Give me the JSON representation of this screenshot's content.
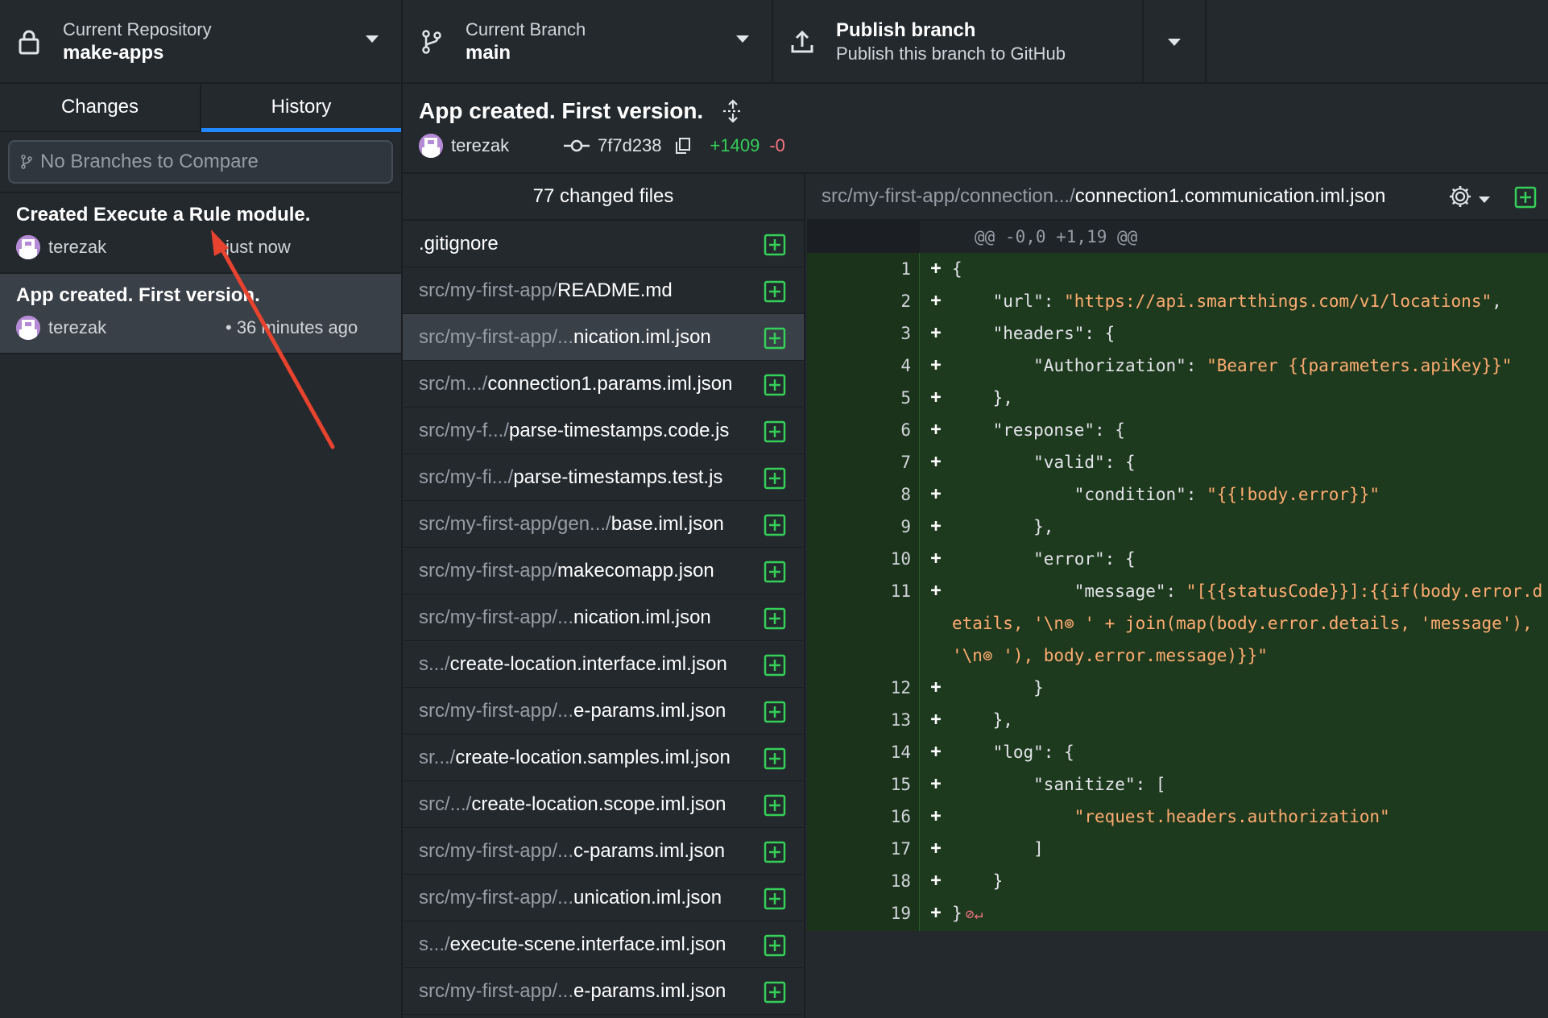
{
  "toolbar": {
    "repo_label": "Current Repository",
    "repo_value": "make-apps",
    "branch_label": "Current Branch",
    "branch_value": "main",
    "publish_label": "Publish branch",
    "publish_sub": "Publish this branch to GitHub"
  },
  "sidebar": {
    "tabs": [
      {
        "label": "Changes",
        "active": false
      },
      {
        "label": "History",
        "active": true
      }
    ],
    "compare_placeholder": "No Branches to Compare",
    "commits": [
      {
        "title": "Created Execute a Rule module.",
        "author": "terezak",
        "time": "just now"
      },
      {
        "title": "App created. First version.",
        "author": "terezak",
        "time": "• 36 minutes ago"
      }
    ]
  },
  "commit": {
    "title": "App created. First version.",
    "author": "terezak",
    "sha": "7f7d238",
    "additions": "+1409",
    "deletions": "-0"
  },
  "files": {
    "header": "77 changed files",
    "items": [
      {
        "dir": "",
        "name": ".gitignore"
      },
      {
        "dir": "src/my-first-app/",
        "name": "README.md"
      },
      {
        "dir": "src/my-first-app/...",
        "name": "nication.iml.json"
      },
      {
        "dir": "src/m.../",
        "name": "connection1.params.iml.json"
      },
      {
        "dir": "src/my-f.../",
        "name": "parse-timestamps.code.js"
      },
      {
        "dir": "src/my-fi.../",
        "name": "parse-timestamps.test.js"
      },
      {
        "dir": "src/my-first-app/gen.../",
        "name": "base.iml.json"
      },
      {
        "dir": "src/my-first-app/",
        "name": "makecomapp.json"
      },
      {
        "dir": "src/my-first-app/...",
        "name": "nication.iml.json"
      },
      {
        "dir": "s.../",
        "name": "create-location.interface.iml.json"
      },
      {
        "dir": "src/my-first-app/...",
        "name": "e-params.iml.json"
      },
      {
        "dir": "sr.../",
        "name": "create-location.samples.iml.json"
      },
      {
        "dir": "src/.../",
        "name": "create-location.scope.iml.json"
      },
      {
        "dir": "src/my-first-app/...",
        "name": "c-params.iml.json"
      },
      {
        "dir": "src/my-first-app/...",
        "name": "unication.iml.json"
      },
      {
        "dir": "s.../",
        "name": "execute-scene.interface.iml.json"
      },
      {
        "dir": "src/my-first-app/...",
        "name": "e-params.iml.json"
      }
    ]
  },
  "diff": {
    "path_dir": "src/my-first-app/connection.../",
    "path_file": "connection1.communication.iml.json",
    "hunk": "@@ -0,0 +1,19 @@",
    "lines": [
      {
        "n": "1",
        "pre": "{",
        "str": "",
        "post": ""
      },
      {
        "n": "2",
        "pre": "    \"url\": ",
        "str": "\"https://api.smartthings.com/v1/locations\"",
        "post": ","
      },
      {
        "n": "3",
        "pre": "    \"headers\": {",
        "str": "",
        "post": ""
      },
      {
        "n": "4",
        "pre": "        \"Authorization\": ",
        "str": "\"Bearer {{parameters.apiKey}}\"",
        "post": ""
      },
      {
        "n": "5",
        "pre": "    },",
        "str": "",
        "post": ""
      },
      {
        "n": "6",
        "pre": "    \"response\": {",
        "str": "",
        "post": ""
      },
      {
        "n": "7",
        "pre": "        \"valid\": {",
        "str": "",
        "post": ""
      },
      {
        "n": "8",
        "pre": "            \"condition\": ",
        "str": "\"{{!body.error}}\"",
        "post": ""
      },
      {
        "n": "9",
        "pre": "        },",
        "str": "",
        "post": ""
      },
      {
        "n": "10",
        "pre": "        \"error\": {",
        "str": "",
        "post": ""
      },
      {
        "n": "11",
        "pre": "            \"message\": ",
        "str": "\"[{{statusCode}}]:{{if(body.error.details, '\\n⊚ ' + join(map(body.error.details, 'message'), '\\n⊚ '), body.error.message)}}\"",
        "post": ""
      },
      {
        "n": "12",
        "pre": "        }",
        "str": "",
        "post": ""
      },
      {
        "n": "13",
        "pre": "    },",
        "str": "",
        "post": ""
      },
      {
        "n": "14",
        "pre": "    \"log\": {",
        "str": "",
        "post": ""
      },
      {
        "n": "15",
        "pre": "        \"sanitize\": [",
        "str": "",
        "post": ""
      },
      {
        "n": "16",
        "pre": "            ",
        "str": "\"request.headers.authorization\"",
        "post": ""
      },
      {
        "n": "17",
        "pre": "        ]",
        "str": "",
        "post": ""
      },
      {
        "n": "18",
        "pre": "    }",
        "str": "",
        "post": ""
      },
      {
        "n": "19",
        "pre": "}",
        "str": "",
        "post": ""
      }
    ]
  },
  "colors": {
    "accent": "#2188ff",
    "addition": "#34d058",
    "deletion": "#f97583",
    "string": "#ffab70",
    "annotation_arrow": "#e8432e"
  }
}
